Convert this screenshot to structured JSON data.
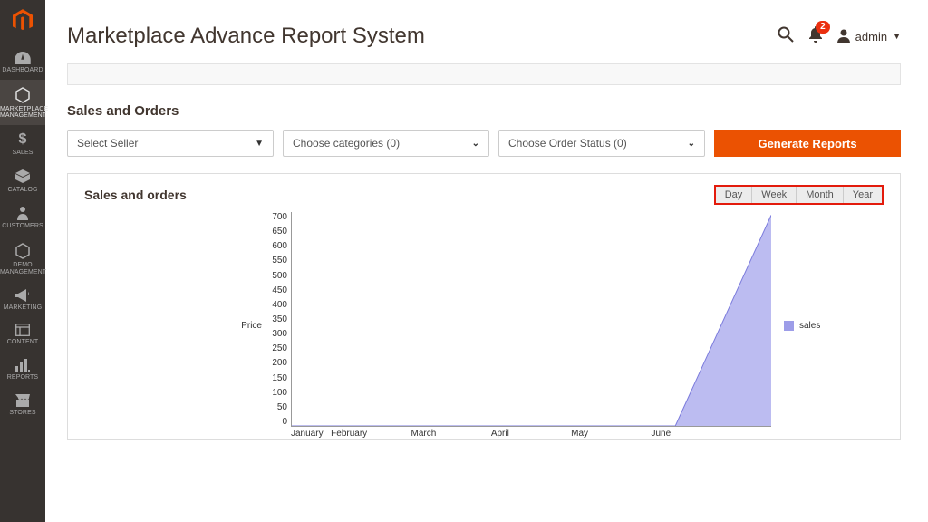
{
  "header": {
    "title": "Marketplace Advance Report System",
    "notification_count": "2",
    "user_label": "admin"
  },
  "sidebar": {
    "items": [
      {
        "label": "DASHBOARD"
      },
      {
        "label": "MARKETPLACE MANAGEMENT"
      },
      {
        "label": "SALES"
      },
      {
        "label": "CATALOG"
      },
      {
        "label": "CUSTOMERS"
      },
      {
        "label": "DEMO MANAGEMENT"
      },
      {
        "label": "MARKETING"
      },
      {
        "label": "CONTENT"
      },
      {
        "label": "REPORTS"
      },
      {
        "label": "STORES"
      }
    ]
  },
  "filters": {
    "section_title": "Sales and Orders",
    "seller_placeholder": "Select Seller",
    "categories_placeholder": "Choose categories (0)",
    "order_status_placeholder": "Choose Order Status (0)",
    "generate_button": "Generate Reports"
  },
  "chart": {
    "title": "Sales and orders",
    "toggles": {
      "day": "Day",
      "week": "Week",
      "month": "Month",
      "year": "Year"
    },
    "y_label": "Price",
    "legend_label": "sales"
  },
  "chart_data": {
    "type": "area",
    "title": "Sales and orders",
    "xlabel": "",
    "ylabel": "Price",
    "ylim": [
      0,
      700
    ],
    "categories": [
      "January",
      "February",
      "March",
      "April",
      "May",
      "June"
    ],
    "series": [
      {
        "name": "sales",
        "values": [
          0,
          0,
          0,
          0,
          0,
          690
        ]
      }
    ],
    "y_ticks": [
      "700",
      "650",
      "600",
      "550",
      "500",
      "450",
      "400",
      "350",
      "300",
      "250",
      "200",
      "150",
      "100",
      "50",
      "0"
    ]
  }
}
